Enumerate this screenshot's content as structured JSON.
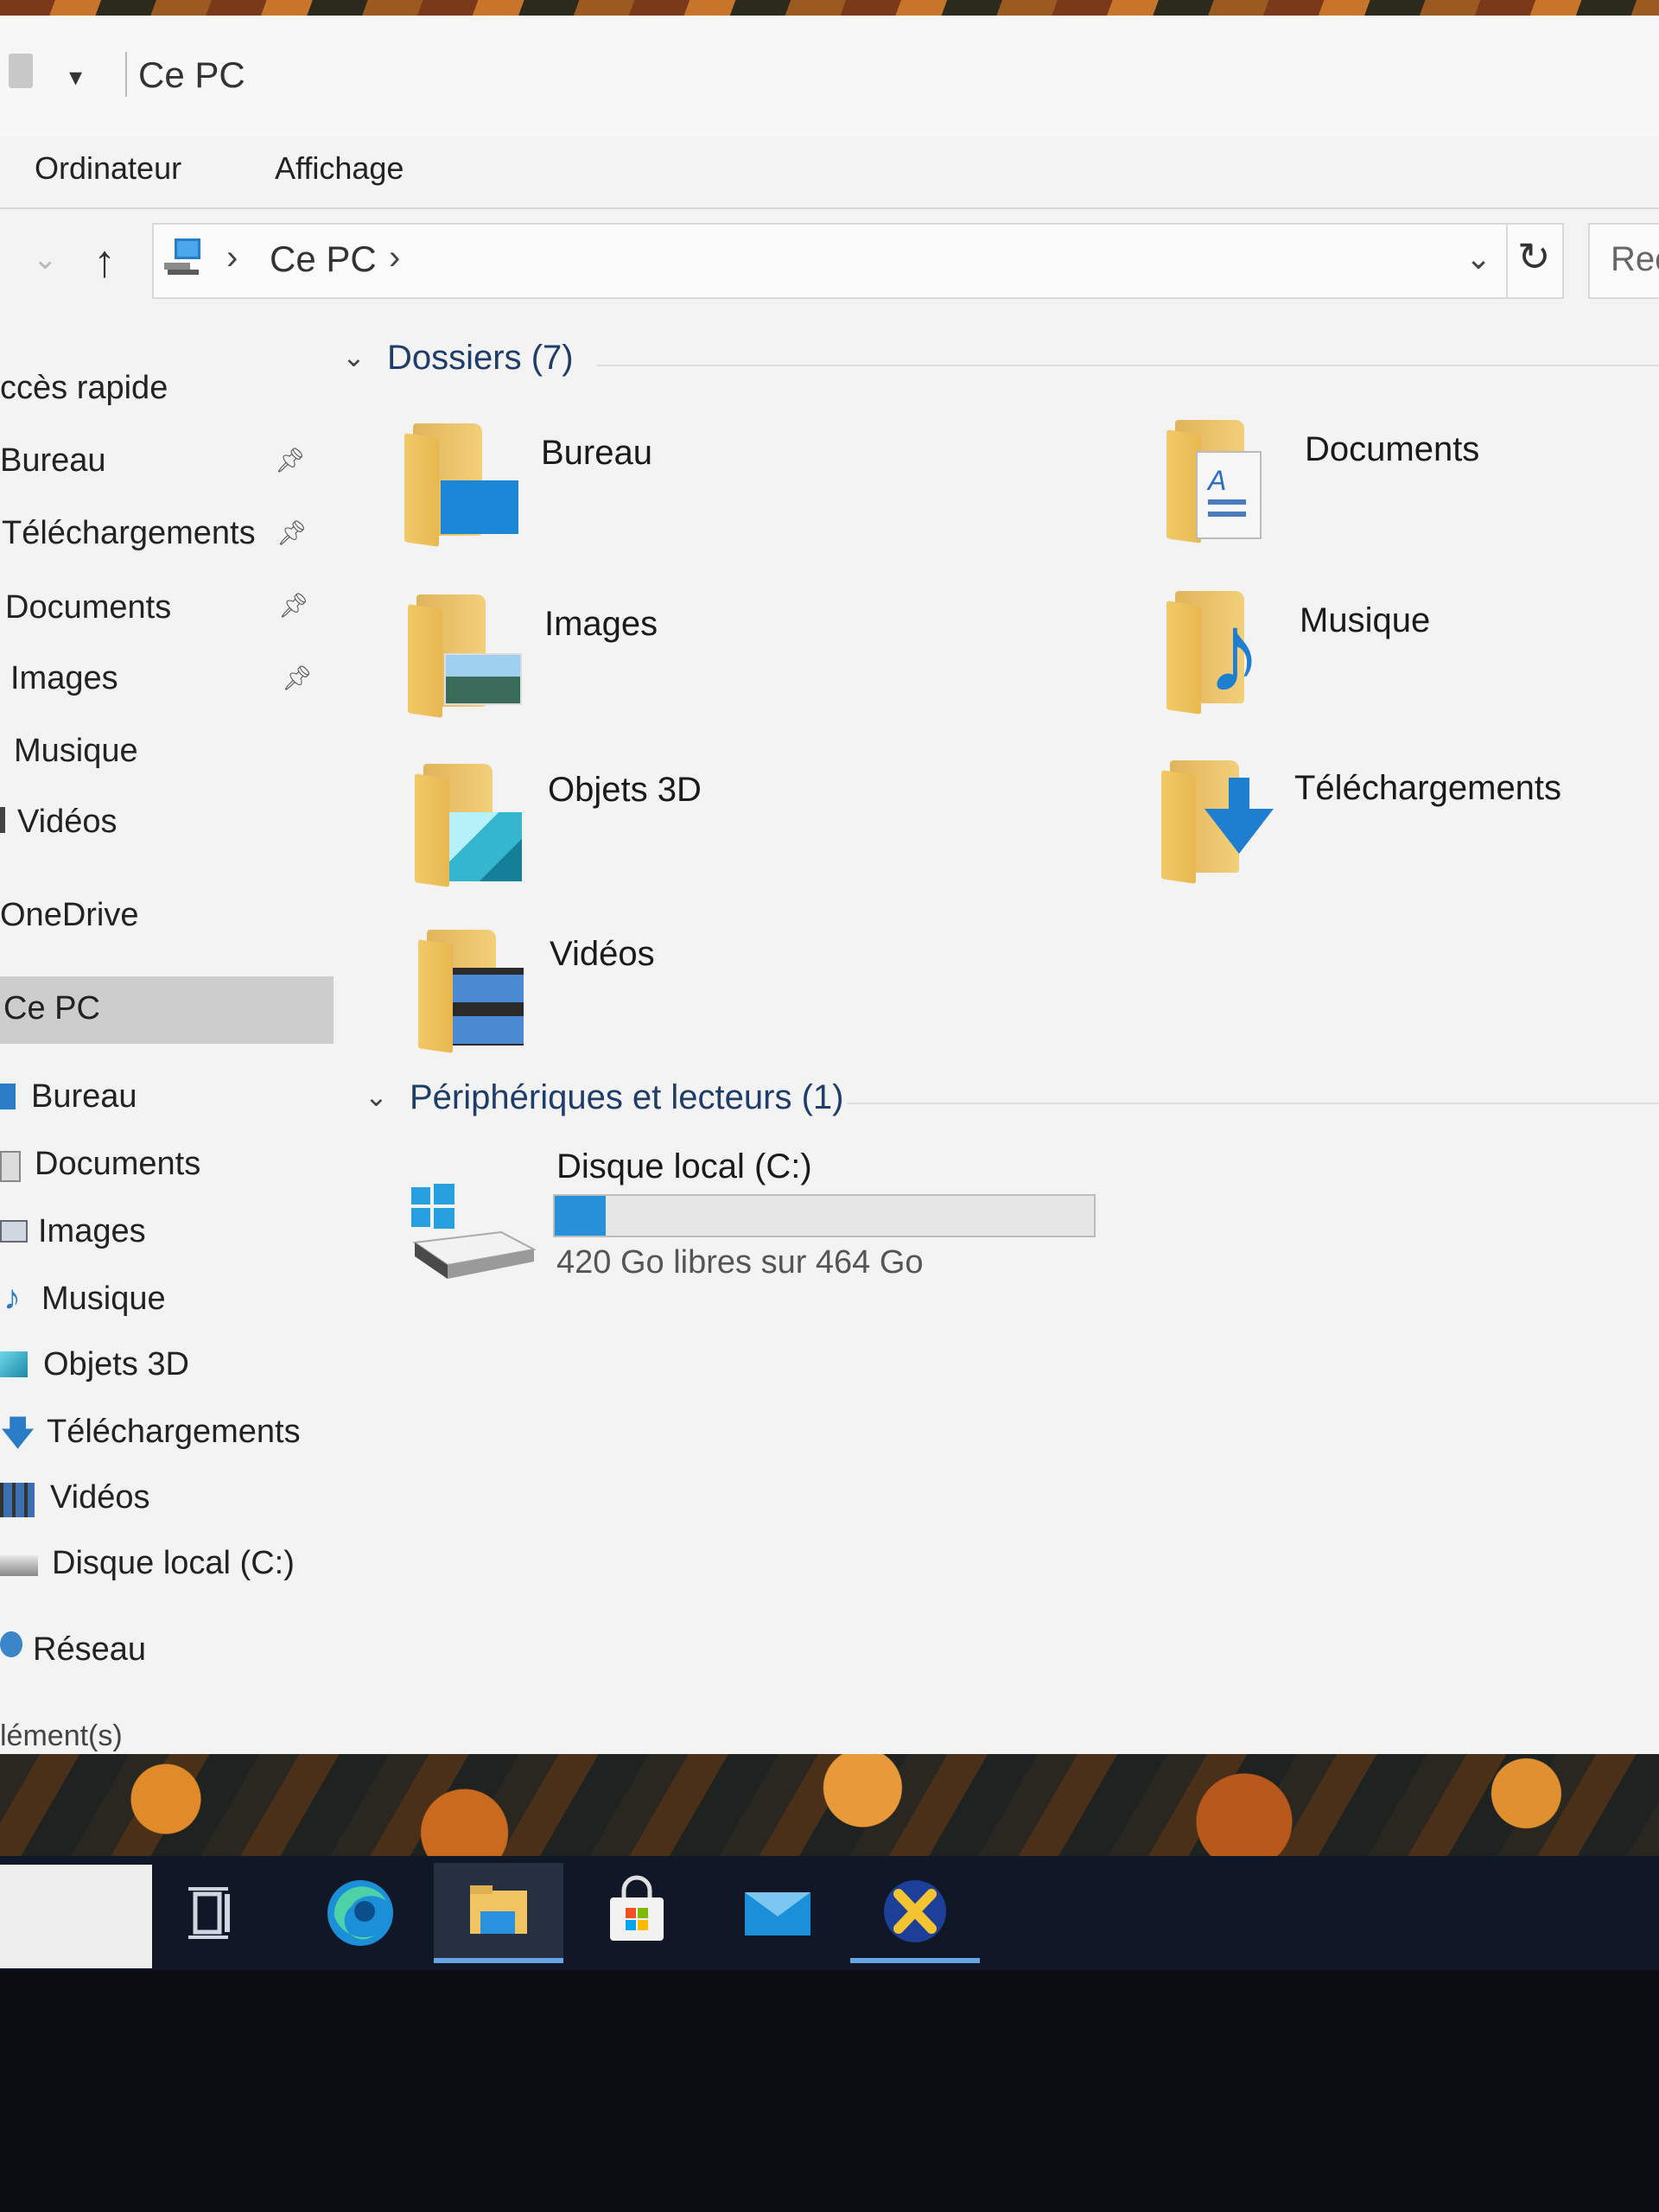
{
  "window": {
    "title": "Ce PC",
    "qa_dropdown": "▾"
  },
  "ribbon": {
    "tabs": [
      "Ordinateur",
      "Affichage"
    ]
  },
  "address": {
    "chevron": "›",
    "location": "Ce PC",
    "search_text": "Rec"
  },
  "sidebar": {
    "quick_access": "ccès rapide",
    "pinned": [
      {
        "label": "Bureau",
        "pinned": true
      },
      {
        "label": "Téléchargements",
        "pinned": true
      },
      {
        "label": "Documents",
        "pinned": true
      },
      {
        "label": "Images",
        "pinned": true
      },
      {
        "label": "Musique",
        "pinned": false
      },
      {
        "label": "Vidéos",
        "pinned": false
      }
    ],
    "onedrive": "OneDrive",
    "this_pc": "Ce PC",
    "pc_items": [
      "Bureau",
      "Documents",
      "Images",
      "Musique",
      "Objets 3D",
      "Téléchargements",
      "Vidéos",
      "Disque local (C:)"
    ],
    "network": "Réseau"
  },
  "content": {
    "folders_header": "Dossiers (7)",
    "folders": [
      "Bureau",
      "Documents",
      "Images",
      "Musique",
      "Objets 3D",
      "Téléchargements",
      "Vidéos"
    ],
    "devices_header": "Périphériques et lecteurs (1)",
    "drive": {
      "name": "Disque local (C:)",
      "free_text": "420 Go libres sur 464 Go",
      "used_fraction": 0.095
    }
  },
  "status": {
    "items": "lément(s)"
  },
  "taskbar": {
    "apps": [
      "task-view",
      "edge",
      "file-explorer",
      "store",
      "mail",
      "app-x"
    ],
    "active_app": "file-explorer"
  },
  "colors": {
    "accent": "#2690d8",
    "folder": "#f0c460",
    "taskbar": "#101726"
  }
}
